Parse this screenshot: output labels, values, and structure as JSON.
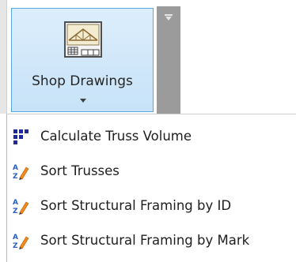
{
  "ribbon": {
    "shop_drawings_label": "Shop Drawings"
  },
  "menu": {
    "items": [
      {
        "label": "Calculate Truss Volume",
        "icon": "grid-icon"
      },
      {
        "label": "Sort Trusses",
        "icon": "sort-az-pencil-icon"
      },
      {
        "label": "Sort Structural Framing by ID",
        "icon": "sort-az-pencil-icon"
      },
      {
        "label": "Sort Structural Framing by Mark",
        "icon": "sort-az-pencil-icon"
      }
    ]
  },
  "colors": {
    "button_bg": "#c7e2f8",
    "button_border": "#5aa7e6",
    "scroll_bar": "#9b9b9b",
    "grid_icon": "#1f2a9a",
    "sort_icon_blue": "#2b5fc7",
    "sort_icon_orange": "#f08a1c"
  }
}
